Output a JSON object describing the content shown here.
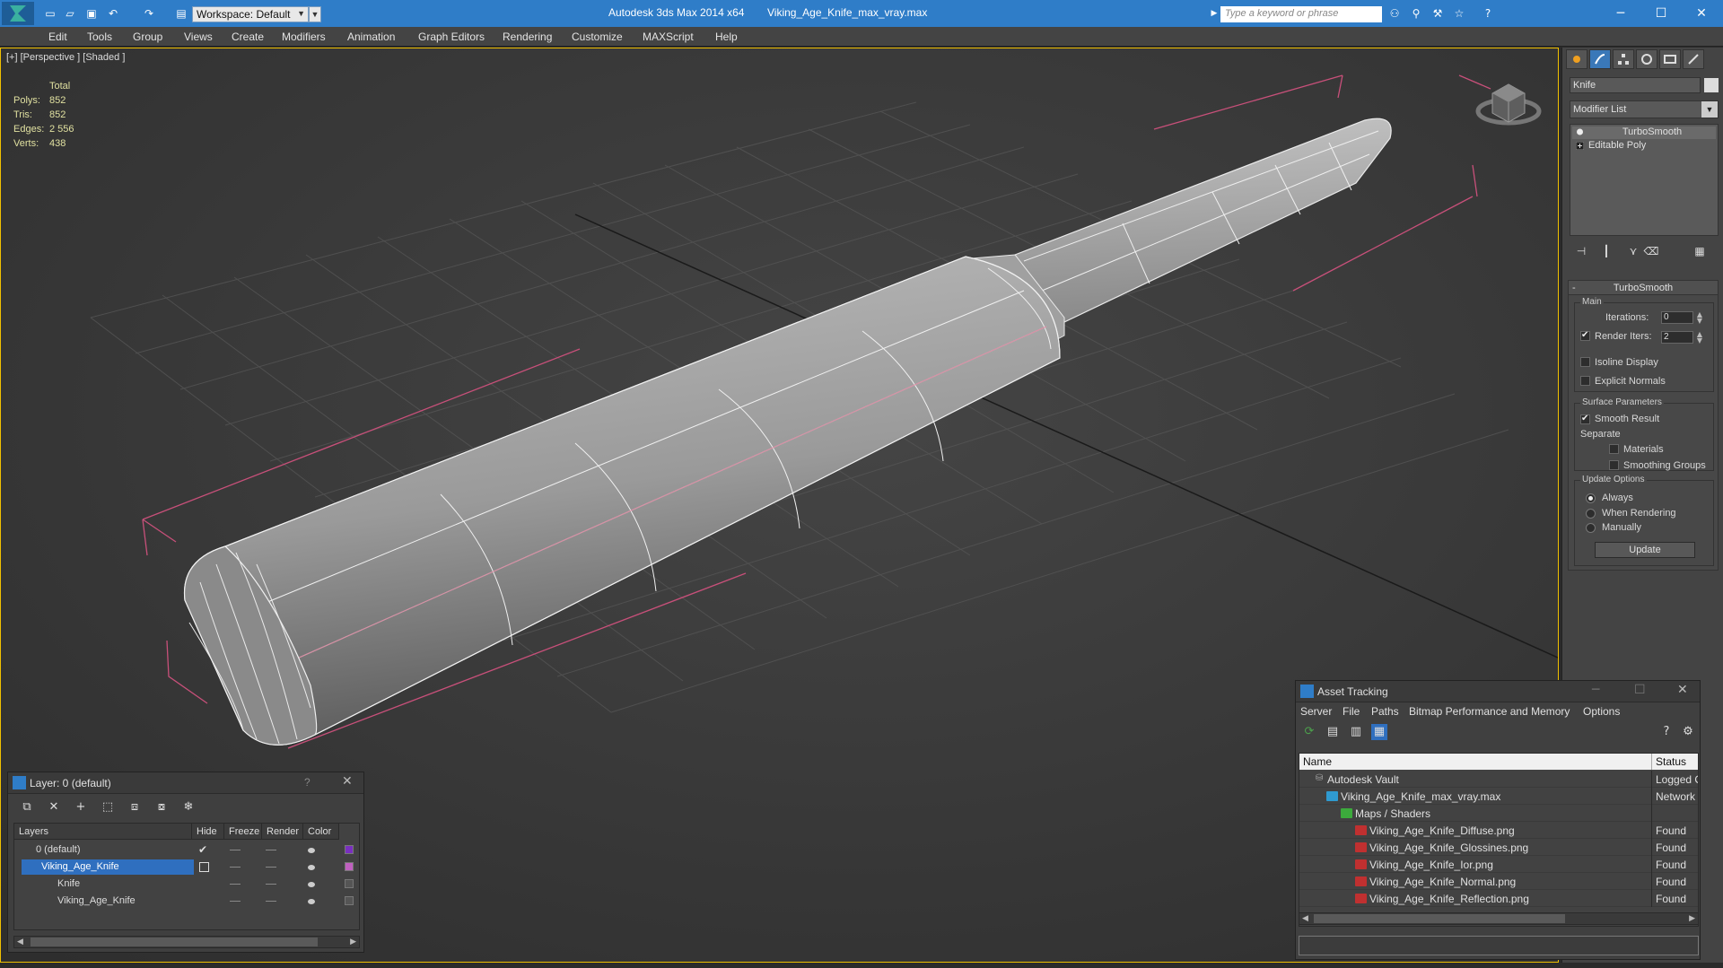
{
  "titlebar": {
    "app_title": "Autodesk 3ds Max  2014 x64",
    "doc_title": "Viking_Age_Knife_max_vray.max",
    "workspace": "Workspace: Default",
    "search_placeholder": "Type a keyword or phrase",
    "accent": "#2f7dc8"
  },
  "menu": [
    "Edit",
    "Tools",
    "Group",
    "Views",
    "Create",
    "Modifiers",
    "Animation",
    "Graph Editors",
    "Rendering",
    "Customize",
    "MAXScript",
    "Help"
  ],
  "viewport": {
    "label": "[+] [Perspective ] [Shaded ]",
    "stats": {
      "total_label": "Total",
      "rows": [
        {
          "label": "Polys:",
          "value": "852"
        },
        {
          "label": "Tris:",
          "value": "852"
        },
        {
          "label": "Edges:",
          "value": "2 556"
        },
        {
          "label": "Verts:",
          "value": "438"
        }
      ]
    }
  },
  "command_panel": {
    "object_name": "Knife",
    "modifier_list": "Modifier List",
    "stack": [
      "TurboSmooth",
      "Editable Poly"
    ],
    "turbosmooth": {
      "title": "TurboSmooth",
      "main_group": "Main",
      "iterations_label": "Iterations:",
      "iterations_value": "0",
      "render_iters_label": "Render Iters:",
      "render_iters_value": "2",
      "render_iters_checked": true,
      "isoline_display": "Isoline Display",
      "explicit_normals": "Explicit Normals",
      "surface_params": "Surface Parameters",
      "smooth_result": "Smooth Result",
      "smooth_result_checked": true,
      "separate": "Separate",
      "materials": "Materials",
      "smoothing_groups": "Smoothing Groups",
      "update_options": "Update Options",
      "always": "Always",
      "when_rendering": "When Rendering",
      "manually": "Manually",
      "update_button": "Update"
    }
  },
  "layer_dialog": {
    "title": "Layer: 0 (default)",
    "help": "?",
    "columns": [
      "Layers",
      "Hide",
      "Freeze",
      "Render",
      "Color"
    ],
    "rows": [
      {
        "name": "0 (default)",
        "color": "#7a2fc0",
        "active": true,
        "selected": false,
        "depth": 0
      },
      {
        "name": "Viking_Age_Knife",
        "color": "#c060c0",
        "active": false,
        "selected": true,
        "depth": 0
      },
      {
        "name": "Knife",
        "color": "#555555",
        "active": false,
        "selected": false,
        "depth": 1
      },
      {
        "name": "Viking_Age_Knife",
        "color": "#555555",
        "active": false,
        "selected": false,
        "depth": 1
      }
    ]
  },
  "asset_dialog": {
    "title": "Asset Tracking",
    "menu": [
      "Server",
      "File",
      "Paths",
      "Bitmap Performance and Memory",
      "Options"
    ],
    "columns": [
      "Name",
      "Status"
    ],
    "rows": [
      {
        "name": "Autodesk Vault",
        "status": "Logged O",
        "depth": 1
      },
      {
        "name": "Viking_Age_Knife_max_vray.max",
        "status": "Network",
        "depth": 2
      },
      {
        "name": "Maps / Shaders",
        "status": "",
        "depth": 3
      },
      {
        "name": "Viking_Age_Knife_Diffuse.png",
        "status": "Found",
        "depth": 4
      },
      {
        "name": "Viking_Age_Knife_Glossines.png",
        "status": "Found",
        "depth": 4
      },
      {
        "name": "Viking_Age_Knife_Ior.png",
        "status": "Found",
        "depth": 4
      },
      {
        "name": "Viking_Age_Knife_Normal.png",
        "status": "Found",
        "depth": 4
      },
      {
        "name": "Viking_Age_Knife_Reflection.png",
        "status": "Found",
        "depth": 4
      }
    ]
  }
}
